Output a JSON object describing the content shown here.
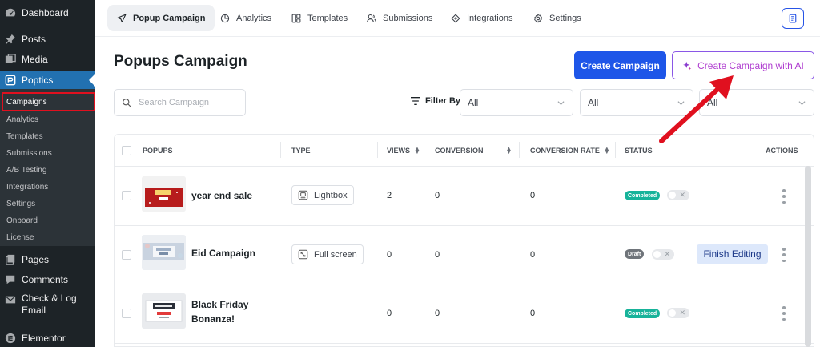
{
  "wp_menu": {
    "dashboard": "Dashboard",
    "posts": "Posts",
    "media": "Media",
    "poptics": "Poptics",
    "submenu": [
      "Campaigns",
      "Analytics",
      "Templates",
      "Submissions",
      "A/B Testing",
      "Integrations",
      "Settings",
      "Onboard",
      "License"
    ],
    "pages": "Pages",
    "comments": "Comments",
    "check_log_line1": "Check & Log",
    "check_log_line2": "Email",
    "elementor": "Elementor"
  },
  "topnav": {
    "tabs": [
      "Popup Campaign",
      "Analytics",
      "Templates",
      "Submissions",
      "Integrations",
      "Settings"
    ]
  },
  "header": {
    "title": "Popups Campaign",
    "create_button": "Create Campaign",
    "ai_button": "Create Campaign with AI"
  },
  "filters": {
    "search_placeholder": "Search Campaign",
    "filter_label": "Filter By",
    "select1": "All",
    "select2": "All",
    "select3": "All"
  },
  "table": {
    "columns": [
      "POPUPS",
      "TYPE",
      "VIEWS",
      "CONVERSION",
      "CONVERSION RATE",
      "STATUS",
      "ACTIONS"
    ],
    "rows": [
      {
        "name": "year end sale",
        "type": "Lightbox",
        "views": "2",
        "conversion": "0",
        "rate": "0",
        "status": "Completed",
        "action": ""
      },
      {
        "name": "Eid Campaign",
        "type": "Full screen",
        "views": "0",
        "conversion": "0",
        "rate": "0",
        "status": "Draft",
        "action": "Finish Editing"
      },
      {
        "name_line1": "Black Friday",
        "name_line2": "Bonanza!",
        "type": "",
        "views": "0",
        "conversion": "0",
        "rate": "0",
        "status": "Completed",
        "action": ""
      }
    ]
  },
  "colors": {
    "primary": "#1e56e8",
    "wp_active": "#2271b1",
    "badge_completed": "#17b39a",
    "badge_draft": "#6f747a",
    "arrow": "#e0101f"
  }
}
